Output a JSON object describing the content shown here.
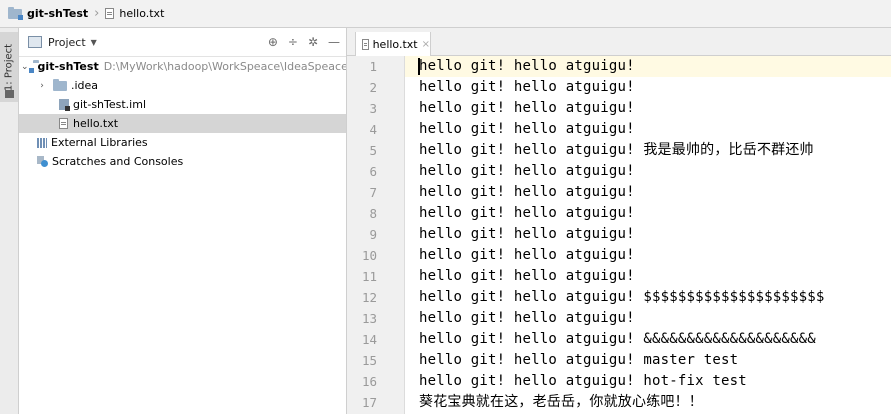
{
  "breadcrumb": {
    "project": "git-shTest",
    "file": "hello.txt"
  },
  "tool_strip": {
    "project_tab_label": "1: Project"
  },
  "project_panel": {
    "title": "Project",
    "root": {
      "name": "git-shTest",
      "path": "D:\\MyWork\\hadoop\\WorkSpeace\\IdeaSpeace"
    },
    "children": [
      {
        "name": ".idea",
        "type": "folder"
      },
      {
        "name": "git-shTest.iml",
        "type": "iml"
      },
      {
        "name": "hello.txt",
        "type": "text",
        "selected": true
      }
    ],
    "extra": [
      {
        "name": "External Libraries"
      },
      {
        "name": "Scratches and Consoles"
      }
    ]
  },
  "editor": {
    "tab_label": "hello.txt",
    "line_numbers": [
      "1",
      "2",
      "3",
      "4",
      "5",
      "6",
      "7",
      "8",
      "9",
      "10",
      "11",
      "12",
      "13",
      "14",
      "15",
      "16",
      "17"
    ],
    "lines": [
      "hello git! hello atguigu!",
      "hello git! hello atguigu!",
      "hello git! hello atguigu!",
      "hello git! hello atguigu!",
      "hello git! hello atguigu! 我是最帅的，比岳不群还帅",
      "hello git! hello atguigu!",
      "hello git! hello atguigu!",
      "hello git! hello atguigu!",
      "hello git! hello atguigu!",
      "hello git! hello atguigu!",
      "hello git! hello atguigu!",
      "hello git! hello atguigu! $$$$$$$$$$$$$$$$$$$$$",
      "hello git! hello atguigu!",
      "hello git! hello atguigu! &&&&&&&&&&&&&&&&&&&&",
      "hello git! hello atguigu! master test",
      "hello git! hello atguigu! hot-fix test",
      "葵花宝典就在这，老岳岳，你就放心练吧！！"
    ]
  }
}
